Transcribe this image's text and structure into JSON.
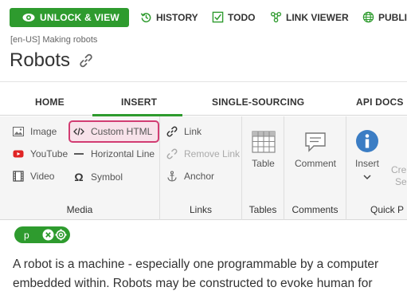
{
  "toolbar": {
    "unlock_label": "UNLOCK & VIEW",
    "history_label": "HISTORY",
    "todo_label": "TODO",
    "link_viewer_label": "LINK VIEWER",
    "publish_label": "PUBLIS"
  },
  "breadcrumb": "[en-US] Making robots",
  "page_title": "Robots",
  "tabs": [
    "HOME",
    "INSERT",
    "SINGLE-SOURCING",
    "API DOCS"
  ],
  "active_tab": "INSERT",
  "ribbon": {
    "media": {
      "label": "Media",
      "image": "Image",
      "custom_html": "Custom HTML",
      "youtube": "YouTube",
      "horizontal_line": "Horizontal Line",
      "video": "Video",
      "symbol": "Symbol"
    },
    "links": {
      "label": "Links",
      "link": "Link",
      "remove_link": "Remove Link",
      "anchor": "Anchor"
    },
    "tables": {
      "label": "Tables",
      "table": "Table"
    },
    "comments": {
      "label": "Comments",
      "comment": "Comment"
    },
    "quick": {
      "label": "Quick P",
      "insert": "Insert",
      "create_1": "Cre",
      "create_2": "Se"
    }
  },
  "tag_pill": {
    "name": "p"
  },
  "content": {
    "line1": "A robot is a machine - especially one programmable by a computer",
    "line2": "embedded within. Robots may be constructed to evoke human for"
  },
  "colors": {
    "accent_green": "#2e9b2e",
    "highlight_pink": "#d23c72",
    "info_blue": "#3b7dc4"
  }
}
